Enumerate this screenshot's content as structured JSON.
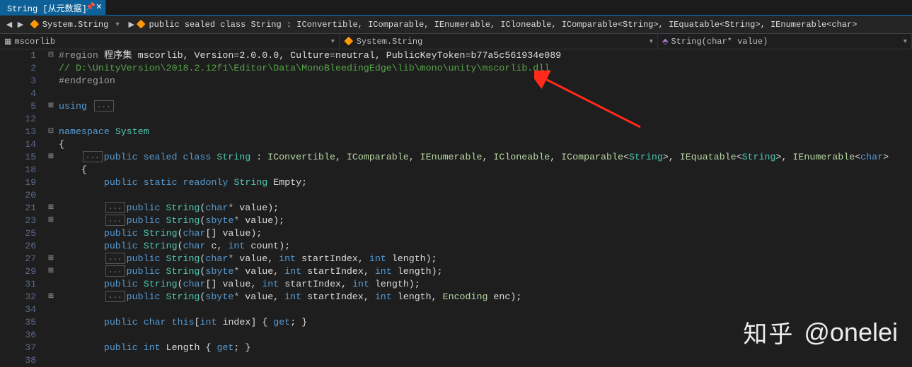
{
  "tab": {
    "title": "String [从元数据]"
  },
  "navbar": {
    "scope": "System.String",
    "signature": "public sealed class String : IConvertible, IComparable, IEnumerable, ICloneable, IComparable<String>, IEquatable<String>, IEnumerable<char>"
  },
  "crumbs": {
    "c1": "mscorlib",
    "c2": "System.String",
    "c3": "String(char* value)"
  },
  "watermark": {
    "logo": "知乎",
    "handle": "@onelei"
  },
  "ellipsis": "...",
  "lines": [
    {
      "n": "1",
      "fold": "⊟",
      "seg": [
        [
          "p",
          "#region"
        ],
        [
          "txt",
          " 程序集 mscorlib, Version=2.0.0.0, Culture=neutral, PublicKeyToken=b77a5c561934e089"
        ]
      ]
    },
    {
      "n": "2",
      "seg": [
        [
          "c",
          "// D:\\UnityVersion\\2018.2.12f1\\Editor\\Data\\MonoBleedingEdge\\lib\\mono\\unity\\mscorlib.dll"
        ]
      ]
    },
    {
      "n": "3",
      "seg": [
        [
          "p",
          "#endregion"
        ]
      ]
    },
    {
      "n": "4",
      "seg": []
    },
    {
      "n": "5",
      "fold": "⊞",
      "seg": [
        [
          "k",
          "using"
        ],
        [
          "txt",
          " "
        ],
        [
          "box",
          "..."
        ]
      ]
    },
    {
      "n": "12",
      "seg": []
    },
    {
      "n": "13",
      "fold": "⊟",
      "seg": [
        [
          "k",
          "namespace"
        ],
        [
          "txt",
          " "
        ],
        [
          "t",
          "System"
        ]
      ]
    },
    {
      "n": "14",
      "seg": [
        [
          "txt",
          "{"
        ]
      ]
    },
    {
      "n": "15",
      "fold": "⊞",
      "ind": 1,
      "seg": [
        [
          "box",
          "..."
        ],
        [
          "k",
          "public sealed class"
        ],
        [
          "txt",
          " "
        ],
        [
          "t",
          "String"
        ],
        [
          "txt",
          " : "
        ],
        [
          "i",
          "IConvertible"
        ],
        [
          "txt",
          ", "
        ],
        [
          "i",
          "IComparable"
        ],
        [
          "txt",
          ", "
        ],
        [
          "i",
          "IEnumerable"
        ],
        [
          "txt",
          ", "
        ],
        [
          "i",
          "ICloneable"
        ],
        [
          "txt",
          ", "
        ],
        [
          "i",
          "IComparable"
        ],
        [
          "txt",
          "<"
        ],
        [
          "t",
          "String"
        ],
        [
          "txt",
          ">, "
        ],
        [
          "i",
          "IEquatable"
        ],
        [
          "txt",
          "<"
        ],
        [
          "t",
          "String"
        ],
        [
          "txt",
          ">, "
        ],
        [
          "i",
          "IEnumerable"
        ],
        [
          "txt",
          "<"
        ],
        [
          "k",
          "char"
        ],
        [
          "txt",
          ">"
        ]
      ]
    },
    {
      "n": "18",
      "ind": 1,
      "seg": [
        [
          "txt",
          "{"
        ]
      ]
    },
    {
      "n": "19",
      "ind": 2,
      "seg": [
        [
          "k",
          "public static readonly"
        ],
        [
          "txt",
          " "
        ],
        [
          "t",
          "String"
        ],
        [
          "txt",
          " Empty;"
        ]
      ]
    },
    {
      "n": "20",
      "ind": 2,
      "seg": []
    },
    {
      "n": "21",
      "fold": "⊞",
      "ind": 2,
      "seg": [
        [
          "box",
          "..."
        ],
        [
          "k",
          "public"
        ],
        [
          "txt",
          " "
        ],
        [
          "t",
          "String"
        ],
        [
          "txt",
          "("
        ],
        [
          "k",
          "char"
        ],
        [
          "op",
          "*"
        ],
        [
          "txt",
          " value);"
        ]
      ]
    },
    {
      "n": "23",
      "fold": "⊞",
      "ind": 2,
      "seg": [
        [
          "box",
          "..."
        ],
        [
          "k",
          "public"
        ],
        [
          "txt",
          " "
        ],
        [
          "t",
          "String"
        ],
        [
          "txt",
          "("
        ],
        [
          "k",
          "sbyte"
        ],
        [
          "op",
          "*"
        ],
        [
          "txt",
          " value);"
        ]
      ]
    },
    {
      "n": "25",
      "ind": 2,
      "seg": [
        [
          "k",
          "public"
        ],
        [
          "txt",
          " "
        ],
        [
          "t",
          "String"
        ],
        [
          "txt",
          "("
        ],
        [
          "k",
          "char"
        ],
        [
          "txt",
          "[] value);"
        ]
      ]
    },
    {
      "n": "26",
      "ind": 2,
      "seg": [
        [
          "k",
          "public"
        ],
        [
          "txt",
          " "
        ],
        [
          "t",
          "String"
        ],
        [
          "txt",
          "("
        ],
        [
          "k",
          "char"
        ],
        [
          "txt",
          " c, "
        ],
        [
          "k",
          "int"
        ],
        [
          "txt",
          " count);"
        ]
      ]
    },
    {
      "n": "27",
      "fold": "⊞",
      "ind": 2,
      "seg": [
        [
          "box",
          "..."
        ],
        [
          "k",
          "public"
        ],
        [
          "txt",
          " "
        ],
        [
          "t",
          "String"
        ],
        [
          "txt",
          "("
        ],
        [
          "k",
          "char"
        ],
        [
          "op",
          "*"
        ],
        [
          "txt",
          " value, "
        ],
        [
          "k",
          "int"
        ],
        [
          "txt",
          " startIndex, "
        ],
        [
          "k",
          "int"
        ],
        [
          "txt",
          " length);"
        ]
      ]
    },
    {
      "n": "29",
      "fold": "⊞",
      "ind": 2,
      "seg": [
        [
          "box",
          "..."
        ],
        [
          "k",
          "public"
        ],
        [
          "txt",
          " "
        ],
        [
          "t",
          "String"
        ],
        [
          "txt",
          "("
        ],
        [
          "k",
          "sbyte"
        ],
        [
          "op",
          "*"
        ],
        [
          "txt",
          " value, "
        ],
        [
          "k",
          "int"
        ],
        [
          "txt",
          " startIndex, "
        ],
        [
          "k",
          "int"
        ],
        [
          "txt",
          " length);"
        ]
      ]
    },
    {
      "n": "31",
      "ind": 2,
      "seg": [
        [
          "k",
          "public"
        ],
        [
          "txt",
          " "
        ],
        [
          "t",
          "String"
        ],
        [
          "txt",
          "("
        ],
        [
          "k",
          "char"
        ],
        [
          "txt",
          "[] value, "
        ],
        [
          "k",
          "int"
        ],
        [
          "txt",
          " startIndex, "
        ],
        [
          "k",
          "int"
        ],
        [
          "txt",
          " length);"
        ]
      ]
    },
    {
      "n": "32",
      "fold": "⊞",
      "ind": 2,
      "seg": [
        [
          "box",
          "..."
        ],
        [
          "k",
          "public"
        ],
        [
          "txt",
          " "
        ],
        [
          "t",
          "String"
        ],
        [
          "txt",
          "("
        ],
        [
          "k",
          "sbyte"
        ],
        [
          "op",
          "*"
        ],
        [
          "txt",
          " value, "
        ],
        [
          "k",
          "int"
        ],
        [
          "txt",
          " startIndex, "
        ],
        [
          "k",
          "int"
        ],
        [
          "txt",
          " length, "
        ],
        [
          "i",
          "Encoding"
        ],
        [
          "txt",
          " enc);"
        ]
      ]
    },
    {
      "n": "34",
      "ind": 2,
      "seg": []
    },
    {
      "n": "35",
      "ind": 2,
      "seg": [
        [
          "k",
          "public"
        ],
        [
          "txt",
          " "
        ],
        [
          "k",
          "char"
        ],
        [
          "txt",
          " "
        ],
        [
          "k",
          "this"
        ],
        [
          "txt",
          "["
        ],
        [
          "k",
          "int"
        ],
        [
          "txt",
          " index] { "
        ],
        [
          "k",
          "get"
        ],
        [
          "txt",
          "; }"
        ]
      ]
    },
    {
      "n": "36",
      "ind": 2,
      "seg": []
    },
    {
      "n": "37",
      "ind": 2,
      "seg": [
        [
          "k",
          "public"
        ],
        [
          "txt",
          " "
        ],
        [
          "k",
          "int"
        ],
        [
          "txt",
          " Length { "
        ],
        [
          "k",
          "get"
        ],
        [
          "txt",
          "; }"
        ]
      ]
    },
    {
      "n": "38",
      "ind": 2,
      "seg": []
    }
  ]
}
